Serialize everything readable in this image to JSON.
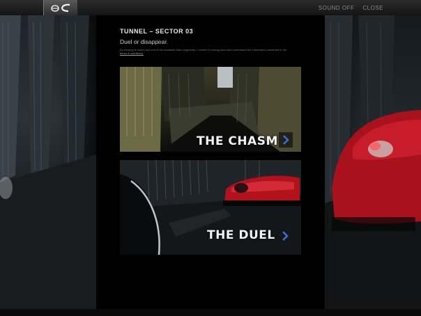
{
  "header": {
    "logo_icon": "ec-logo-icon",
    "sound_label": "SOUND OFF",
    "close_label": "CLOSE"
  },
  "panel": {
    "title": "TUNNEL – SECTOR 03",
    "subtitle": "Duel or disappear.",
    "disclaimer": "By electing to watch any one of the available video segments, I confirm to having seen and understand the information presented in the",
    "terms_link": "terms & conditions."
  },
  "cards": [
    {
      "label": "THE CHASM",
      "arrow_icon": "chevron-right-icon"
    },
    {
      "label": "THE DUEL",
      "arrow_icon": "chevron-right-icon"
    }
  ],
  "colors": {
    "accent_arrow": "#3b6fd1",
    "car_red": "#b3121c",
    "background": "#000000"
  }
}
